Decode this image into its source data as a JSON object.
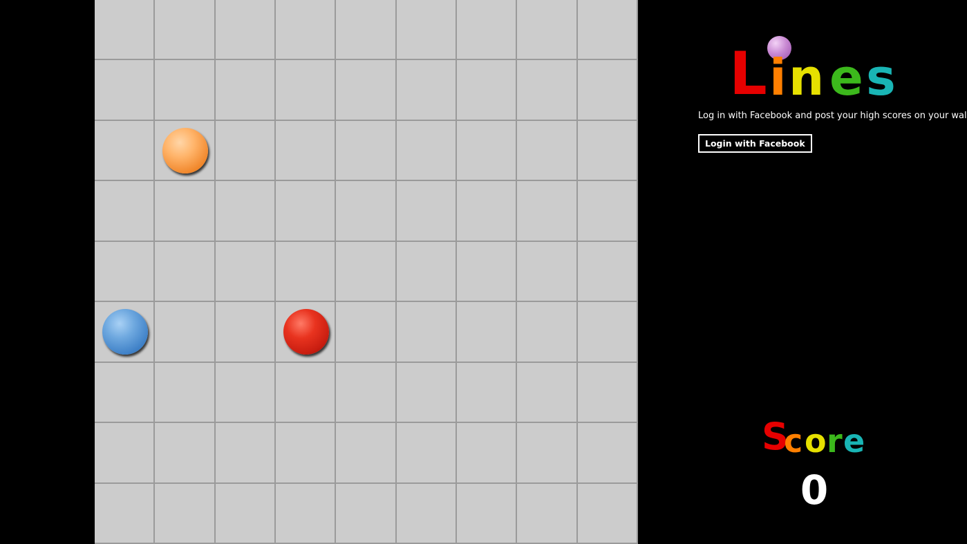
{
  "game": {
    "rows": 9,
    "cols": 9,
    "balls": [
      {
        "row": 2,
        "col": 1,
        "color": "orange"
      },
      {
        "row": 5,
        "col": 0,
        "color": "blue"
      },
      {
        "row": 5,
        "col": 3,
        "color": "red"
      }
    ]
  },
  "colors": {
    "background": "#000000",
    "cell": "#cccccc",
    "grid_line": "#9a9a9a",
    "ball_orange": "#f59a3c",
    "ball_blue": "#3d7fc6",
    "ball_red": "#c81d10",
    "logo_letters": [
      "#e60000",
      "#ff7f00",
      "#e6e000",
      "#3cb81c",
      "#19b5b5"
    ],
    "logo_dot": "#c98ad3",
    "text": "#ffffff"
  },
  "logo": {
    "text": "Lines",
    "letters": [
      "L",
      "i",
      "n",
      "e",
      "s"
    ]
  },
  "facebook": {
    "prompt": "Log in with Facebook and post your high scores on your wall",
    "button_label": "Login with Facebook"
  },
  "score": {
    "title": "Score",
    "letters": [
      "S",
      "c",
      "o",
      "r",
      "e"
    ],
    "value": "0"
  }
}
